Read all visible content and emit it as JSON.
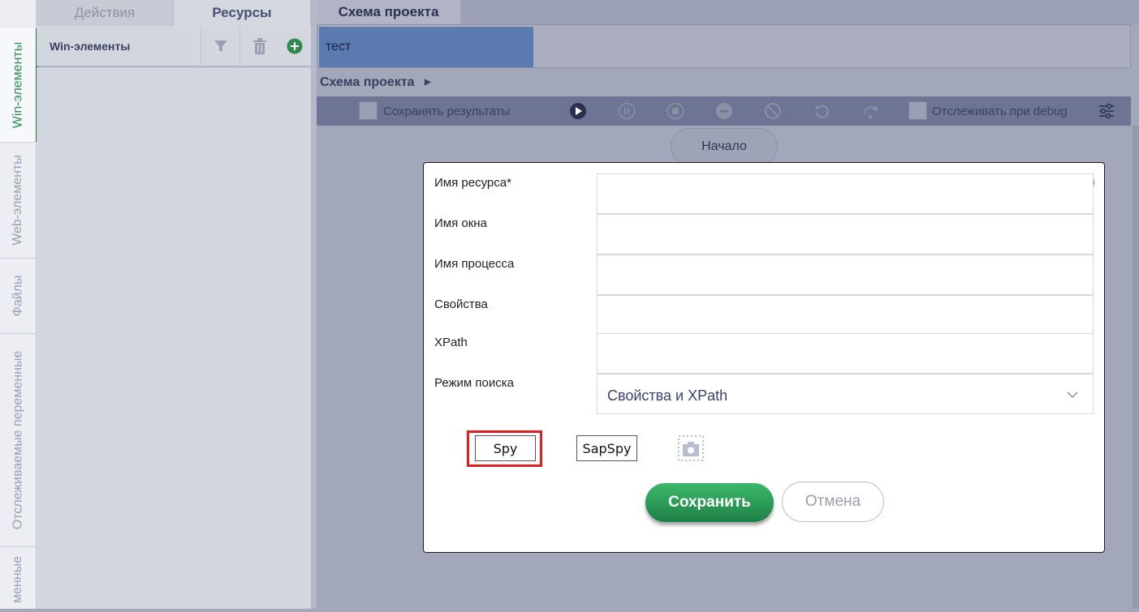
{
  "left_tabs": {
    "items": [
      {
        "label": "Win-элементы"
      },
      {
        "label": "Web-элементы"
      },
      {
        "label": "Файлы"
      },
      {
        "label": "Отслеживаемые переменные"
      },
      {
        "label": "менные"
      }
    ]
  },
  "top_tabs": {
    "actions": "Действия",
    "resources": "Ресурсы"
  },
  "resource_header": {
    "label": "Win-элементы"
  },
  "right": {
    "tab": "Схема проекта",
    "open_tab": "тест",
    "breadcrumb": "Схема проекта",
    "toolbar": {
      "save_results": "Сохранять результаты",
      "track_debug": "Отслеживать при debug"
    },
    "start_node": "Начало"
  },
  "dialog": {
    "fields": [
      {
        "label": "Имя ресурса*",
        "value": ""
      },
      {
        "label": "Имя окна",
        "value": ""
      },
      {
        "label": "Имя процесса",
        "value": ""
      },
      {
        "label": "Свойства",
        "value": ""
      },
      {
        "label": "XPath",
        "value": ""
      }
    ],
    "search_mode": {
      "label": "Режим поиска",
      "value": "Свойства и XPath"
    },
    "spy_label": "Spy",
    "sapspy_label": "SapSpy",
    "save_label": "Сохранить",
    "cancel_label": "Отмена"
  },
  "colors": {
    "accent_green": "#2e8b57",
    "highlight_red": "#e02020",
    "chip_blue": "#5a7ab0"
  }
}
